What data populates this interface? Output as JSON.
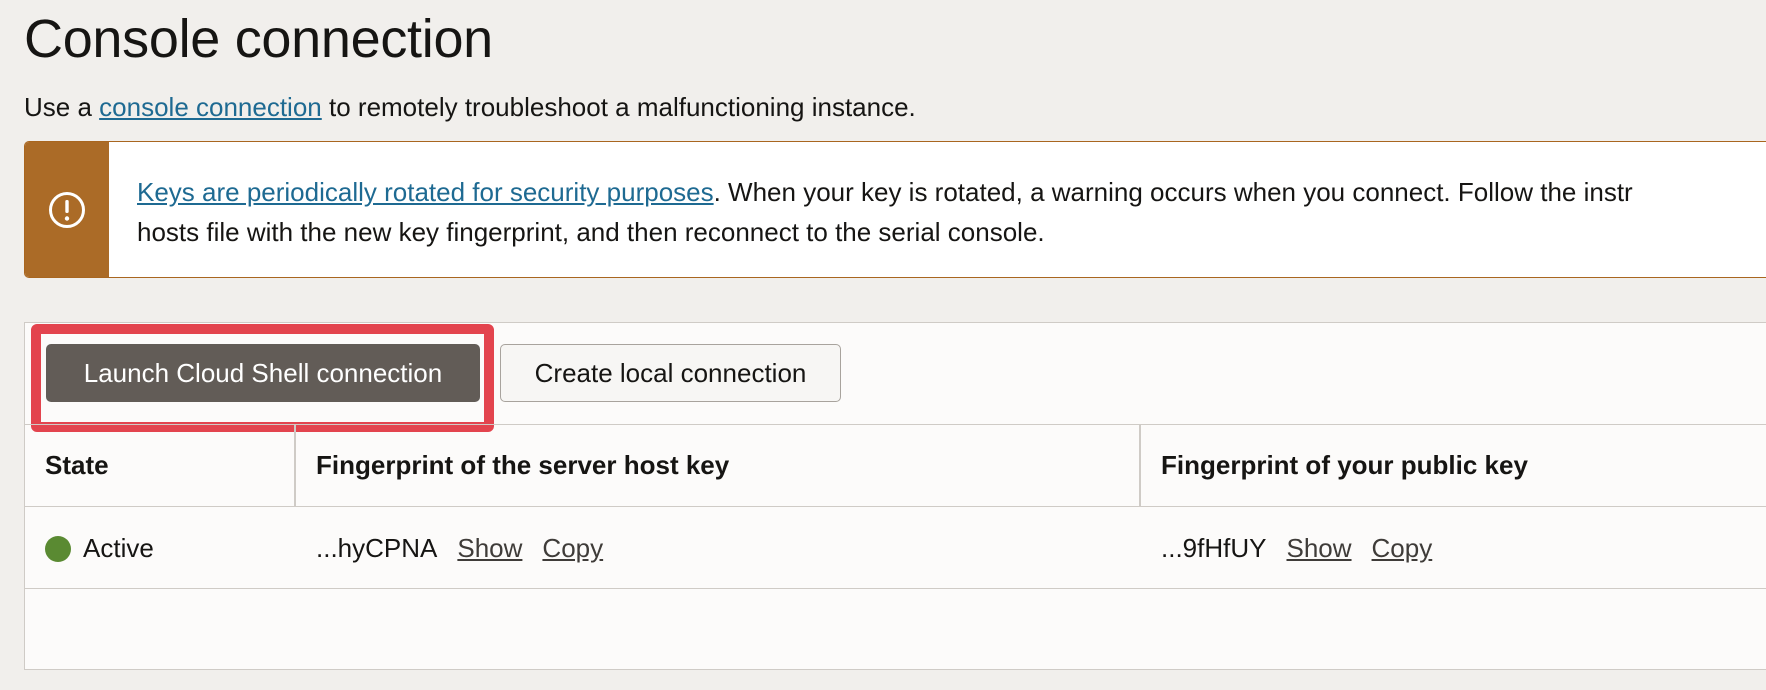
{
  "page": {
    "title": "Console connection",
    "intro_prefix": "Use a",
    "intro_link": "console connection",
    "intro_suffix": "to remotely troubleshoot a malfunctioning instance."
  },
  "alert": {
    "icon": "exclamation-circle-icon",
    "link": "Keys are periodically rotated for security purposes",
    "line1_rest": ". When your key is rotated, a warning occurs when you connect. Follow the instr",
    "line2": "hosts file with the new key fingerprint, and then reconnect to the serial console."
  },
  "toolbar": {
    "launch_label": "Launch Cloud Shell connection",
    "create_label": "Create local connection"
  },
  "table": {
    "headers": [
      "State",
      "Fingerprint of the server host key",
      "Fingerprint of your public key"
    ],
    "rows": [
      {
        "state": "Active",
        "server_fingerprint": "...hyCPNA",
        "public_fingerprint": "...9fHfUY",
        "show_label": "Show",
        "copy_label": "Copy"
      }
    ]
  },
  "colors": {
    "accent_link": "#1e6a92",
    "warning": "#ab6b27",
    "primary_button": "#625c57",
    "highlight": "#e3444e",
    "status_active": "#5a8a32"
  }
}
